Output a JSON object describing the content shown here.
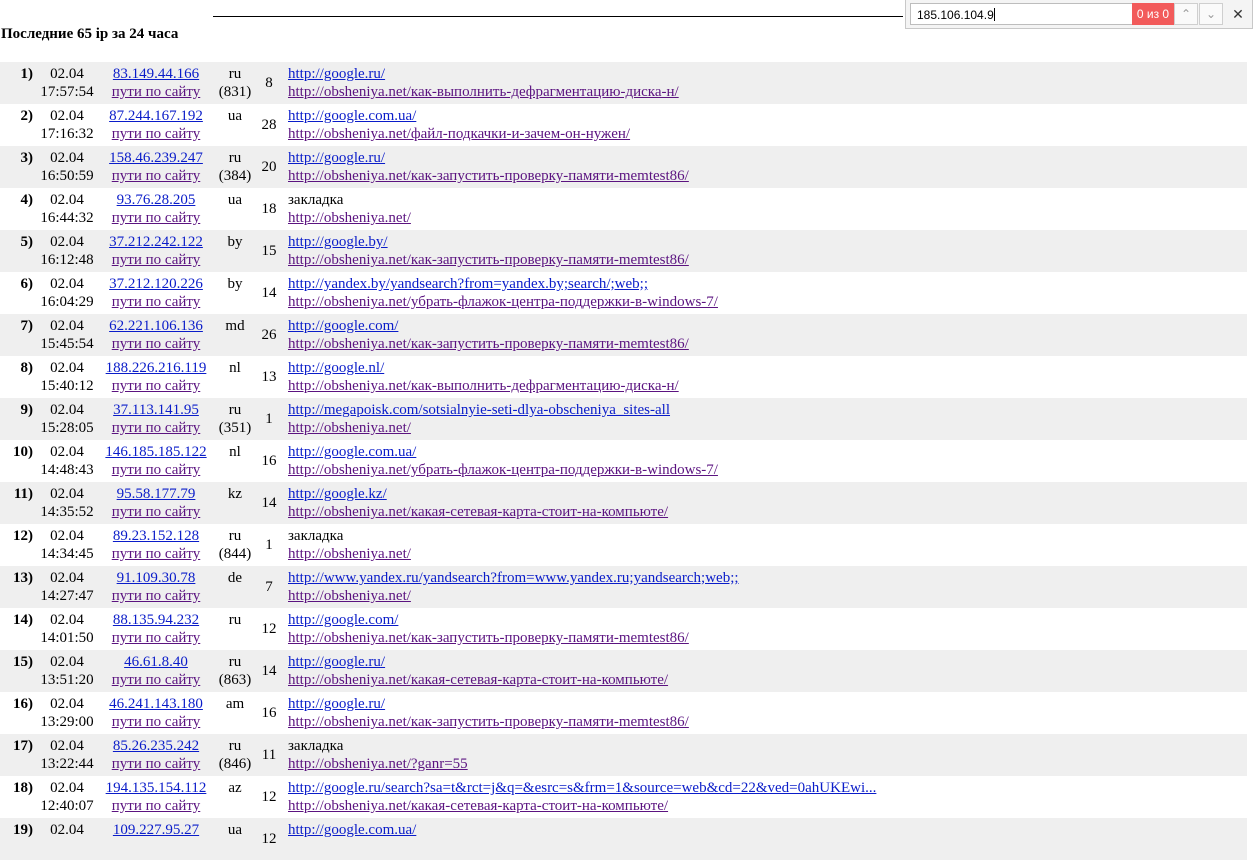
{
  "heading": "Последние 65 ip за 24 часа",
  "find_bar": {
    "query": "185.106.104.9",
    "match_count": "0 из 0",
    "prev_icon": "chevron-up-icon",
    "next_icon": "chevron-down-icon",
    "close_icon": "close-icon",
    "colors": {
      "no_match_bg": "#f25b5b"
    }
  },
  "path_link_label": "пути по сайту",
  "rows": [
    {
      "num": "1)",
      "date": "02.04",
      "time": "17:57:54",
      "ip": "83.149.44.166",
      "country": "ru",
      "country_count": "(831)",
      "hits": "8",
      "ref1": "http://google.ru/",
      "ref1_plain": false,
      "ref2": "http://obsheniya.net/как-выполнить-дефрагментацию-диска-н/"
    },
    {
      "num": "2)",
      "date": "02.04",
      "time": "17:16:32",
      "ip": "87.244.167.192",
      "country": "ua",
      "country_count": "",
      "hits": "28",
      "ref1": "http://google.com.ua/",
      "ref1_plain": false,
      "ref2": "http://obsheniya.net/файл-подкачки-и-зачем-он-нужен/"
    },
    {
      "num": "3)",
      "date": "02.04",
      "time": "16:50:59",
      "ip": "158.46.239.247",
      "country": "ru",
      "country_count": "(384)",
      "hits": "20",
      "ref1": "http://google.ru/",
      "ref1_plain": false,
      "ref2": "http://obsheniya.net/как-запустить-проверку-памяти-memtest86/"
    },
    {
      "num": "4)",
      "date": "02.04",
      "time": "16:44:32",
      "ip": "93.76.28.205",
      "country": "ua",
      "country_count": "",
      "hits": "18",
      "ref1": "закладка",
      "ref1_plain": true,
      "ref2": "http://obsheniya.net/"
    },
    {
      "num": "5)",
      "date": "02.04",
      "time": "16:12:48",
      "ip": "37.212.242.122",
      "country": "by",
      "country_count": "",
      "hits": "15",
      "ref1": "http://google.by/",
      "ref1_plain": false,
      "ref2": "http://obsheniya.net/как-запустить-проверку-памяти-memtest86/"
    },
    {
      "num": "6)",
      "date": "02.04",
      "time": "16:04:29",
      "ip": "37.212.120.226",
      "country": "by",
      "country_count": "",
      "hits": "14",
      "ref1": "http://yandex.by/yandsearch?from=yandex.by;search/;web;;",
      "ref1_plain": false,
      "ref2": "http://obsheniya.net/убрать-флажок-центра-поддержки-в-windows-7/"
    },
    {
      "num": "7)",
      "date": "02.04",
      "time": "15:45:54",
      "ip": "62.221.106.136",
      "country": "md",
      "country_count": "",
      "hits": "26",
      "ref1": "http://google.com/",
      "ref1_plain": false,
      "ref2": "http://obsheniya.net/как-запустить-проверку-памяти-memtest86/"
    },
    {
      "num": "8)",
      "date": "02.04",
      "time": "15:40:12",
      "ip": "188.226.216.119",
      "country": "nl",
      "country_count": "",
      "hits": "13",
      "ref1": "http://google.nl/",
      "ref1_plain": false,
      "ref2": "http://obsheniya.net/как-выполнить-дефрагментацию-диска-н/"
    },
    {
      "num": "9)",
      "date": "02.04",
      "time": "15:28:05",
      "ip": "37.113.141.95",
      "country": "ru",
      "country_count": "(351)",
      "hits": "1",
      "ref1": "http://megapoisk.com/sotsialnyie-seti-dlya-obscheniya_sites-all",
      "ref1_plain": false,
      "ref2": "http://obsheniya.net/"
    },
    {
      "num": "10)",
      "date": "02.04",
      "time": "14:48:43",
      "ip": "146.185.185.122",
      "country": "nl",
      "country_count": "",
      "hits": "16",
      "ref1": "http://google.com.ua/",
      "ref1_plain": false,
      "ref2": "http://obsheniya.net/убрать-флажок-центра-поддержки-в-windows-7/"
    },
    {
      "num": "11)",
      "date": "02.04",
      "time": "14:35:52",
      "ip": "95.58.177.79",
      "country": "kz",
      "country_count": "",
      "hits": "14",
      "ref1": "http://google.kz/",
      "ref1_plain": false,
      "ref2": "http://obsheniya.net/какая-сетевая-карта-стоит-на-компьюте/"
    },
    {
      "num": "12)",
      "date": "02.04",
      "time": "14:34:45",
      "ip": "89.23.152.128",
      "country": "ru",
      "country_count": "(844)",
      "hits": "1",
      "ref1": "закладка",
      "ref1_plain": true,
      "ref2": "http://obsheniya.net/"
    },
    {
      "num": "13)",
      "date": "02.04",
      "time": "14:27:47",
      "ip": "91.109.30.78",
      "country": "de",
      "country_count": "",
      "hits": "7",
      "ref1": "http://www.yandex.ru/yandsearch?from=www.yandex.ru;yandsearch;web;;",
      "ref1_plain": false,
      "ref2": "http://obsheniya.net/"
    },
    {
      "num": "14)",
      "date": "02.04",
      "time": "14:01:50",
      "ip": "88.135.94.232",
      "country": "ru",
      "country_count": "",
      "hits": "12",
      "ref1": "http://google.com/",
      "ref1_plain": false,
      "ref2": "http://obsheniya.net/как-запустить-проверку-памяти-memtest86/"
    },
    {
      "num": "15)",
      "date": "02.04",
      "time": "13:51:20",
      "ip": "46.61.8.40",
      "country": "ru",
      "country_count": "(863)",
      "hits": "14",
      "ref1": "http://google.ru/",
      "ref1_plain": false,
      "ref2": "http://obsheniya.net/какая-сетевая-карта-стоит-на-компьюте/"
    },
    {
      "num": "16)",
      "date": "02.04",
      "time": "13:29:00",
      "ip": "46.241.143.180",
      "country": "am",
      "country_count": "",
      "hits": "16",
      "ref1": "http://google.ru/",
      "ref1_plain": false,
      "ref2": "http://obsheniya.net/как-запустить-проверку-памяти-memtest86/"
    },
    {
      "num": "17)",
      "date": "02.04",
      "time": "13:22:44",
      "ip": "85.26.235.242",
      "country": "ru",
      "country_count": "(846)",
      "hits": "11",
      "ref1": "закладка",
      "ref1_plain": true,
      "ref2": "http://obsheniya.net/?ganr=55"
    },
    {
      "num": "18)",
      "date": "02.04",
      "time": "12:40:07",
      "ip": "194.135.154.112",
      "country": "az",
      "country_count": "",
      "hits": "12",
      "ref1": "http://google.ru/search?sa=t&rct=j&q=&esrc=s&frm=1&source=web&cd=22&ved=0ahUKEwi...",
      "ref1_plain": false,
      "ref2": "http://obsheniya.net/какая-сетевая-карта-стоит-на-компьюте/"
    },
    {
      "num": "19)",
      "date": "02.04",
      "time": "",
      "ip": "109.227.95.27",
      "country": "ua",
      "country_count": "",
      "hits": "12",
      "ref1": "http://google.com.ua/",
      "ref1_plain": false,
      "ref2": ""
    }
  ]
}
